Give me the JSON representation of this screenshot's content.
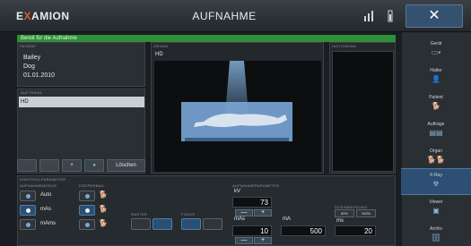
{
  "header": {
    "logo_prefix": "E",
    "logo_x": "X",
    "logo_suffix": "AMION",
    "title": "AUFNAHME",
    "close_label": "✕"
  },
  "status": {
    "text": "Bereit für die Aufnahme"
  },
  "patient": {
    "label": "PATIENT",
    "name": "Bailey",
    "species": "Dog",
    "date": "01.01.2010"
  },
  "auftraege": {
    "label": "AUFTRÄGE",
    "selected": "HD",
    "buttons": [
      "",
      "",
      "+",
      "●",
      "Löschen"
    ]
  },
  "organ": {
    "label": "ORGAN",
    "name": "HD"
  },
  "histogram": {
    "label": "HISTOGRAM"
  },
  "bottom": {
    "section_label": "KONTROLLPARAMETER",
    "mode_label": "AUFNAHMEMODUS",
    "body_label": "KÖRPERBAU",
    "modes": [
      "Auto",
      "mAs",
      "mAms"
    ],
    "raster_label": "RASTER",
    "fokus_label": "FOKUS",
    "params_label": "AUFNAHMEPARAMETER",
    "kv_label": "kV",
    "kv_value": "73",
    "mas_label": "mAs",
    "mas_value": "10",
    "ma_label": "mA",
    "ma_value": "500",
    "ms_label": "ms",
    "ms_value": "20",
    "dose_label": "DOSISMESSUNG",
    "dose_low": "80%",
    "dose_high": "100%",
    "minus": "—",
    "plus": "+"
  },
  "sidebar": {
    "items": [
      {
        "label": "Gerät",
        "icon": "device-icon"
      },
      {
        "label": "Halter",
        "icon": "owner-icon"
      },
      {
        "label": "Patient",
        "icon": "patient-icon"
      },
      {
        "label": "Aufträge",
        "icon": "orders-icon"
      },
      {
        "label": "Organ",
        "icon": "organ-icon"
      },
      {
        "label": "X-Ray",
        "icon": "xray-icon"
      },
      {
        "label": "Viewer",
        "icon": "viewer-icon"
      },
      {
        "label": "Archiv",
        "icon": "archive-icon"
      }
    ],
    "active": "X-Ray"
  },
  "colors": {
    "status_green": "#2f8f38",
    "accent_blue": "#2c4f73",
    "logo_x": "#e25b2b"
  }
}
